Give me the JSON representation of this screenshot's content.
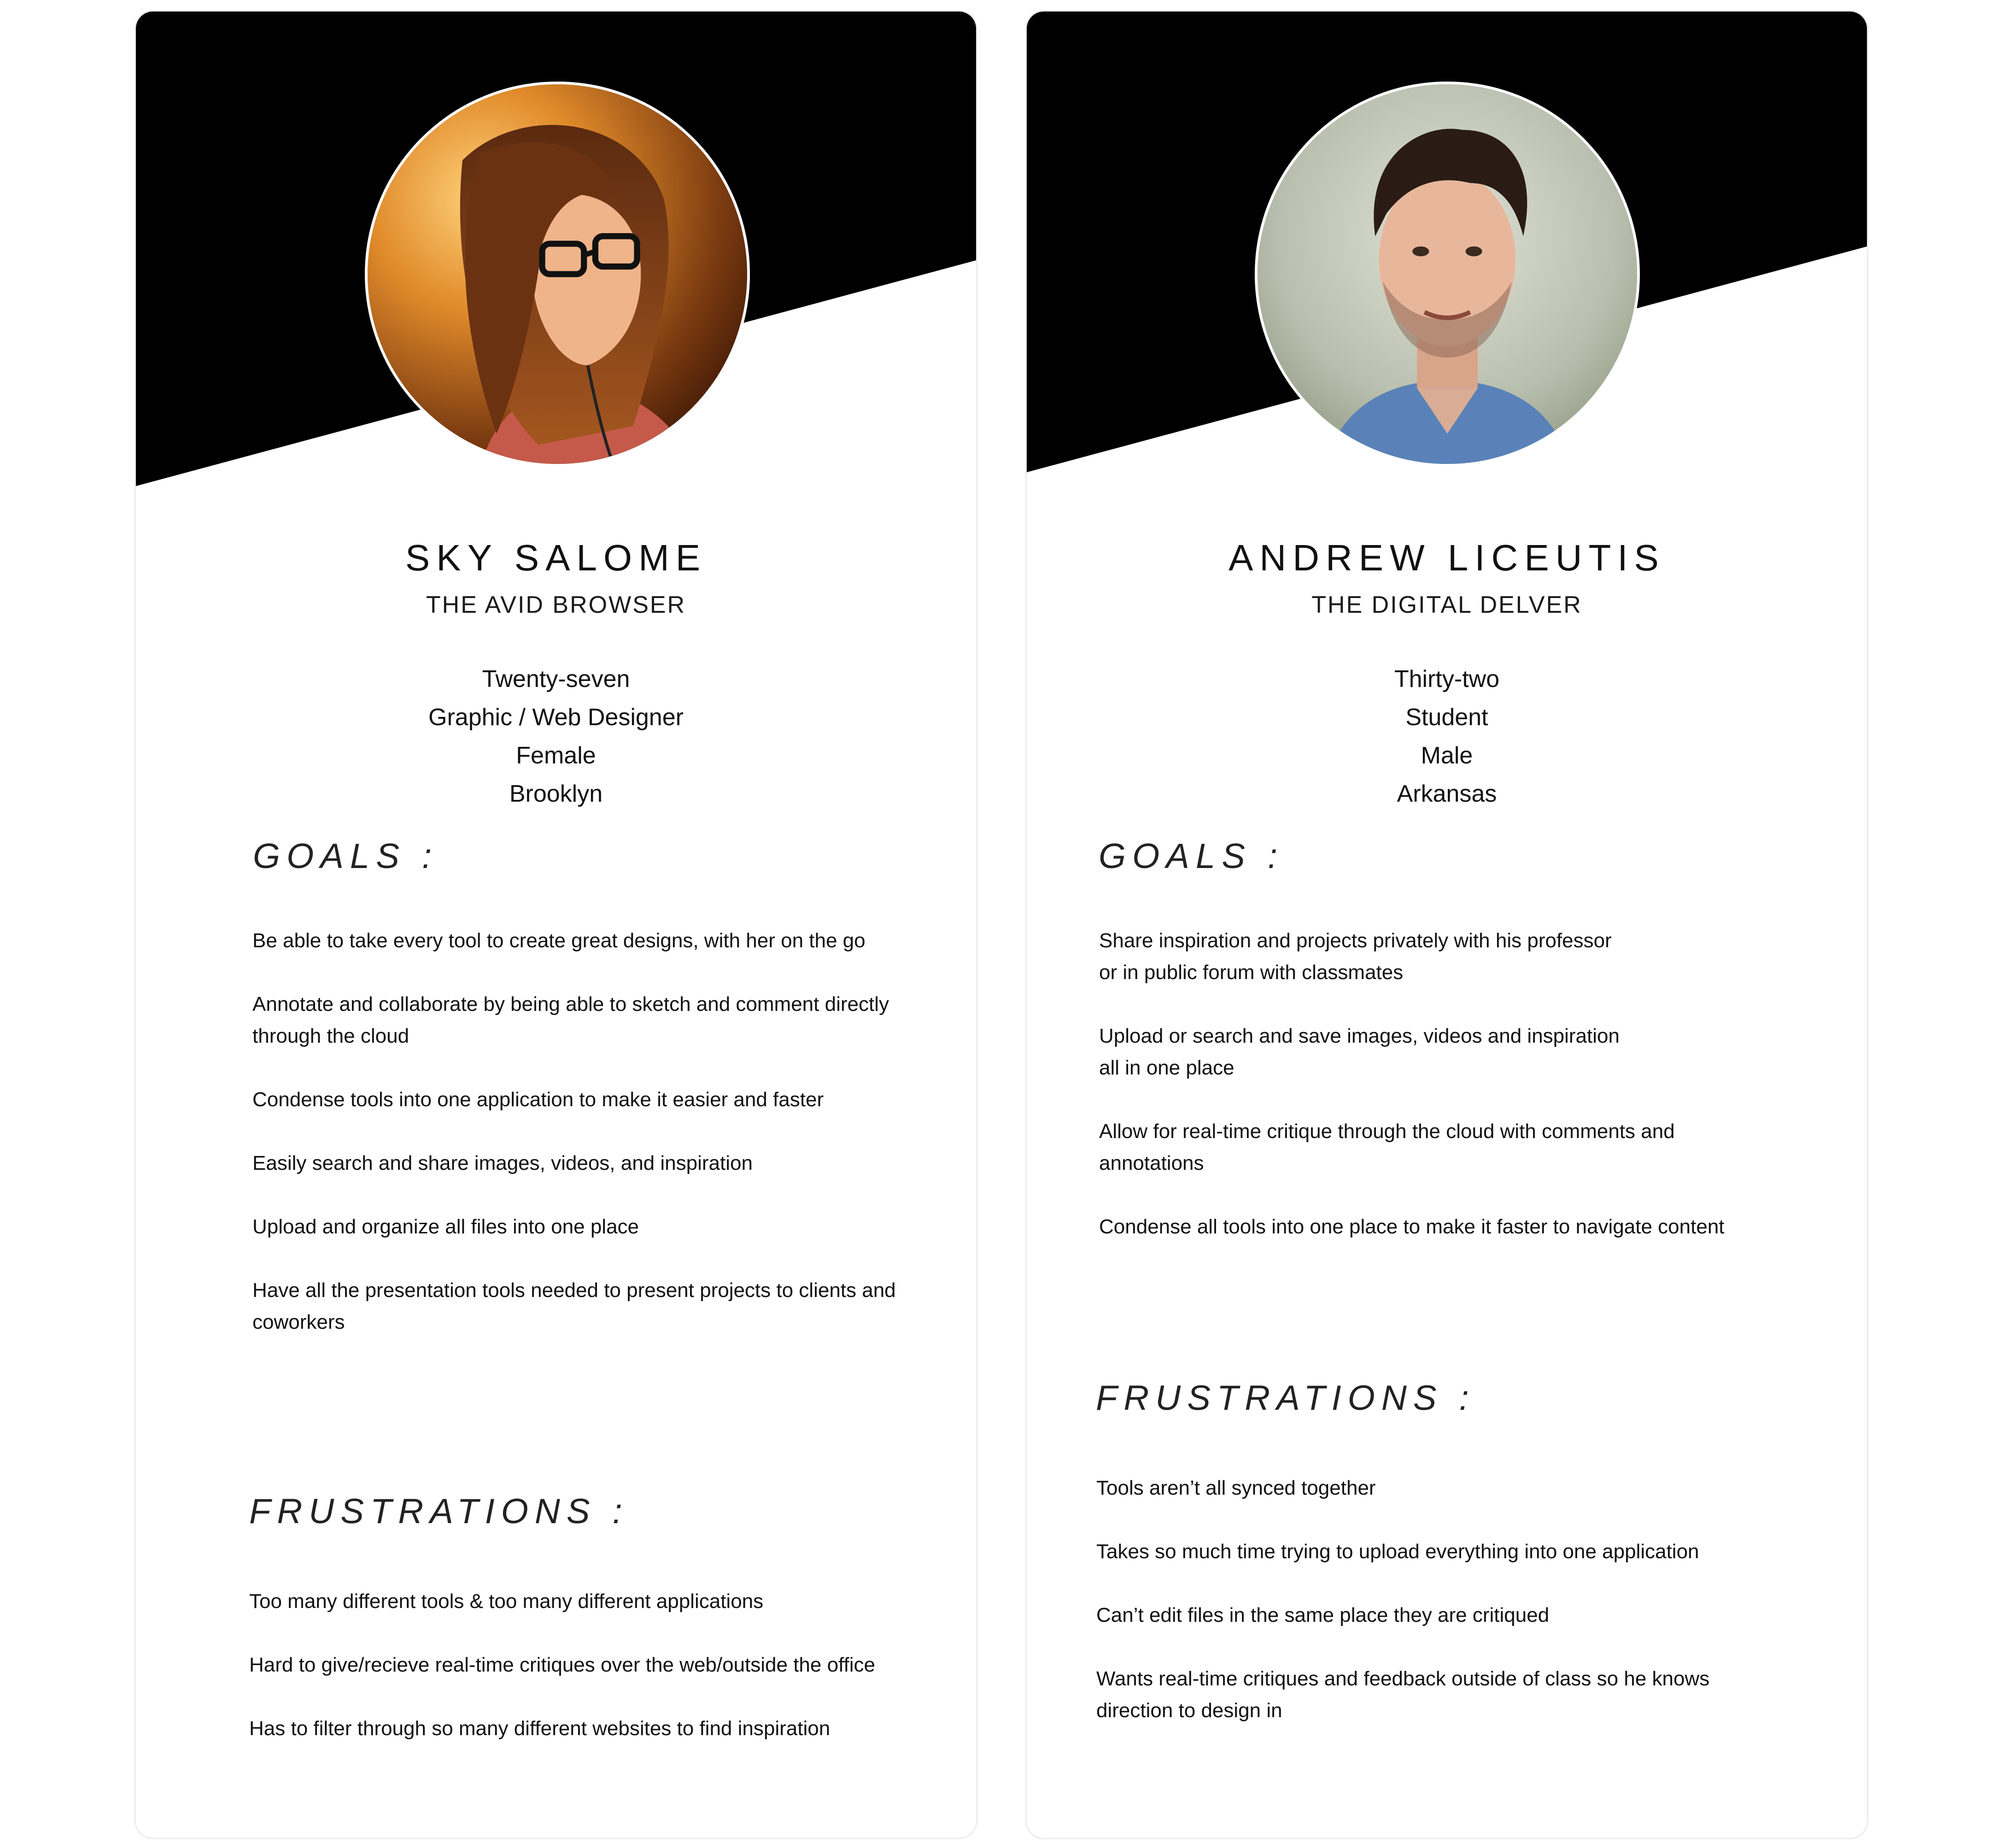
{
  "personas": [
    {
      "name": "SKY SALOME",
      "role": "THE AVID BROWSER",
      "age": "Twenty-seven",
      "occupation": "Graphic / Web Designer",
      "gender": "Female",
      "location": "Brooklyn",
      "goals_heading": "GOALS :",
      "goals": [
        "Be able to take every tool to create great designs, with her on the go",
        "Annotate and collaborate by being able to sketch and comment directly\nthrough the cloud",
        "Condense tools into one application to make it easier and faster",
        "Easily search and share images, videos, and inspiration",
        "Upload and organize all files into one place",
        "Have all the presentation tools needed to present projects to clients and\ncoworkers"
      ],
      "frustrations_heading": "FRUSTRATIONS :",
      "frustrations": [
        "Too many different tools & too many different applications",
        "Hard to give/recieve real-time critiques over the web/outside the office",
        "Has to filter through so many different websites to find inspiration"
      ]
    },
    {
      "name": "ANDREW LICEUTIS",
      "role": "THE DIGITAL DELVER",
      "age": "Thirty-two",
      "occupation": "Student",
      "gender": "Male",
      "location": "Arkansas",
      "goals_heading": "GOALS :",
      "goals": [
        "Share inspiration and projects privately with his professor\nor in public forum with classmates",
        "Upload or search and save images, videos and inspiration\nall in one place",
        "Allow for real-time critique through the cloud with comments and\nannotations",
        "Condense all tools into one place to make it faster to navigate content"
      ],
      "frustrations_heading": "FRUSTRATIONS :",
      "frustrations": [
        "Tools aren’t all synced together",
        "Takes so much time trying to upload everything into one application",
        "Can’t edit files in the same place they are critiqued",
        "Wants real-time critiques and feedback outside of class so he knows\ndirection to design in"
      ]
    }
  ],
  "colors": {
    "banner": "#000000",
    "card_border": "#ececec",
    "text": "#111111"
  },
  "icons": {
    "left_avatar": "woman-with-glasses-photo",
    "right_avatar": "man-portrait-photo"
  }
}
